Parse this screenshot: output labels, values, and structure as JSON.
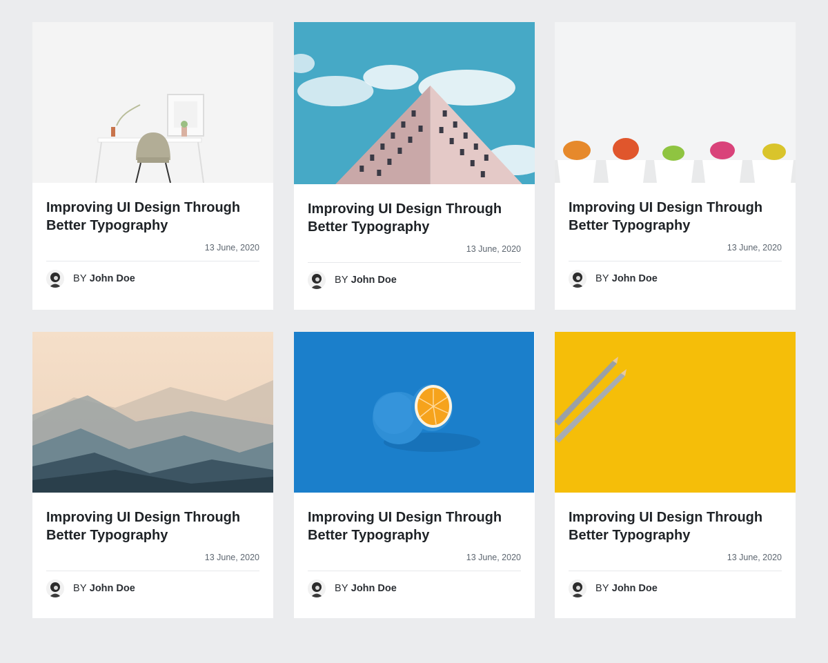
{
  "posts": [
    {
      "image": "white desk with chair and plant",
      "title": "Improving UI Design Through Better Typography",
      "date": "13 June, 2020",
      "by_prefix": "BY",
      "author": "John Doe"
    },
    {
      "image": "building corner against blue sky",
      "title": "Improving UI Design Through Better Typography",
      "date": "13 June, 2020",
      "by_prefix": "BY",
      "author": "John Doe"
    },
    {
      "image": "row of potted cacti",
      "title": "Improving UI Design Through Better Typography",
      "date": "13 June, 2020",
      "by_prefix": "BY",
      "author": "John Doe"
    },
    {
      "image": "misty mountain ranges",
      "title": "Improving UI Design Through Better Typography",
      "date": "13 June, 2020",
      "by_prefix": "BY",
      "author": "John Doe"
    },
    {
      "image": "blue painted orange on blue background",
      "title": "Improving UI Design Through Better Typography",
      "date": "13 June, 2020",
      "by_prefix": "BY",
      "author": "John Doe"
    },
    {
      "image": "two pencils on yellow background",
      "title": "Improving UI Design Through Better Typography",
      "date": "13 June, 2020",
      "by_prefix": "BY",
      "author": "John Doe"
    }
  ],
  "colors": {
    "page_background": "#ebecee",
    "card_background": "#ffffff",
    "title_text": "#1e2226",
    "date_text": "#5d6670"
  }
}
